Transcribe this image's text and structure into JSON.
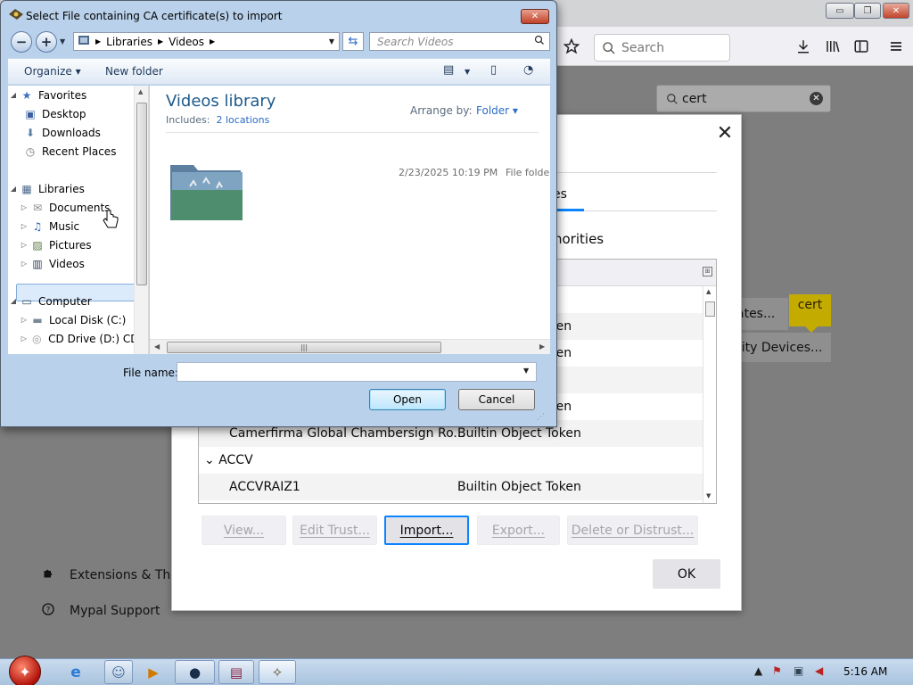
{
  "browser": {
    "search_placeholder": "Search",
    "window_controls": {
      "minimize": "▭",
      "maximize": "❐",
      "close": "✕"
    },
    "toolbar_icons": [
      "star-icon",
      "download-icon",
      "library-icon",
      "sidebar-icon",
      "menu-icon"
    ]
  },
  "prefs": {
    "search_value": "cert",
    "clear_icon": "✕",
    "certificates_button": "View Certificates...",
    "certificates_visible": "ates...",
    "security_devices_visible": "rity Devices...",
    "highlight_tip": "cert",
    "sidebar": [
      {
        "label": "Extensions & Themes",
        "icon": "puzzle-icon"
      },
      {
        "label": "Mypal Support",
        "icon": "help-icon"
      }
    ]
  },
  "cert_manager": {
    "close": "✕",
    "tab_visible": "es",
    "intro_visible": "horities",
    "rows": [
      {
        "c1": "",
        "c2": "",
        "visible_c2": ""
      },
      {
        "c1": "",
        "c2": "Token",
        "visible_c2": "ken"
      },
      {
        "c1": "",
        "c2": "Token",
        "visible_c2": "ken"
      },
      {
        "c1": "",
        "c2": "",
        "visible_c2": ""
      },
      {
        "c1": "",
        "c2": "Token",
        "visible_c2": "ken"
      },
      {
        "c1": "Camerfirma Global Chambersign Ro...",
        "c2": "Builtin Object Token",
        "visible_c2": "Builtin Object Token"
      },
      {
        "group": "ACCV",
        "group_prefix": "⌄"
      },
      {
        "c1": "ACCVRAIZ1",
        "c2": "Builtin Object Token",
        "visible_c2": "Builtin Object Token"
      }
    ],
    "buttons": {
      "view": "View...",
      "edit_trust": "Edit Trust...",
      "import": "Import...",
      "export": "Export...",
      "delete": "Delete or Distrust...",
      "ok": "OK"
    }
  },
  "file_dialog": {
    "title": "Select File containing CA certificate(s) to import",
    "breadcrumb": [
      "Libraries",
      "Videos"
    ],
    "search_placeholder": "Search Videos",
    "organize": "Organize ▾",
    "new_folder": "New folder",
    "nav": {
      "favorites": "Favorites",
      "desktop": "Desktop",
      "downloads": "Downloads",
      "recent_places": "Recent Places",
      "libraries": "Libraries",
      "documents": "Documents",
      "music": "Music",
      "pictures": "Pictures",
      "videos": "Videos",
      "computer": "Computer",
      "local_disk": "Local Disk (C:)",
      "cd_drive": "CD Drive (D:) CDI"
    },
    "library_title": "Videos library",
    "includes_label": "Includes:",
    "includes_link": "2 locations",
    "arrange_by": "Arrange by:",
    "arrange_value": "Folder ▾",
    "item": {
      "date": "2/23/2025 10:19 PM",
      "type": "File folder"
    },
    "file_name_label": "File name:",
    "file_name_value": "",
    "open": "Open",
    "cancel": "Cancel"
  },
  "taskbar": {
    "clock": "5:16 AM",
    "tasks": [
      "ie-icon",
      "finder-icon",
      "media-player-icon",
      "mypal-icon",
      "winrar-icon",
      "explorer-icon"
    ]
  },
  "colors": {
    "accent": "#0a84ff",
    "tip": "#c4ab00",
    "dialog_frame": "#b9d1ea"
  }
}
